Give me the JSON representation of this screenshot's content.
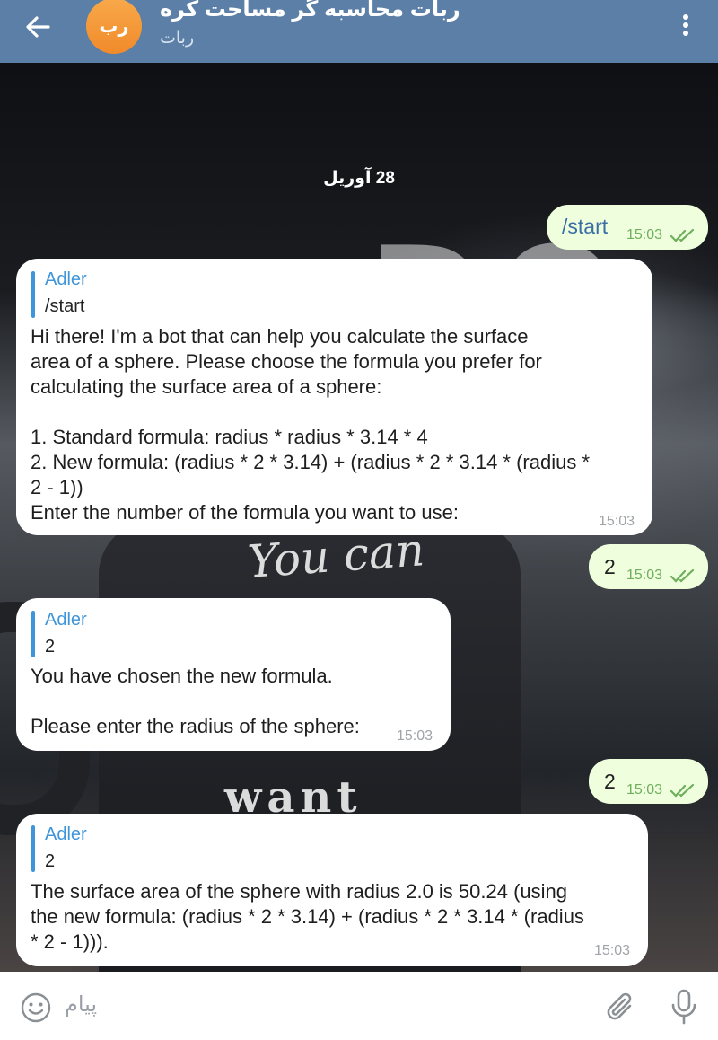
{
  "header": {
    "title": "ربات محاسبه گر مساحت کره",
    "subtitle": "ربات",
    "avatar_initials": "رب",
    "back_icon": "arrow-left-icon",
    "menu_icon": "more-vertical-icon"
  },
  "chat": {
    "date": "28 آوریل",
    "background_words": [
      "You can",
      "want"
    ],
    "messages": [
      {
        "direction": "out",
        "text": "/start",
        "time": "15:03"
      },
      {
        "direction": "in",
        "reply_name": "Adler",
        "reply_text": "/start",
        "text": "Hi there! I'm a bot that can help you calculate the surface\narea of a sphere. Please choose the formula you prefer for\ncalculating the surface area of a sphere:\n\n1. Standard formula: radius * radius * 3.14 * 4\n2. New formula: (radius * 2 * 3.14) + (radius * 2 * 3.14 * (radius *\n2 - 1))\nEnter the number of the formula you want to use:",
        "time": "15:03"
      },
      {
        "direction": "out",
        "text": "2",
        "time": "15:03"
      },
      {
        "direction": "in",
        "reply_name": "Adler",
        "reply_text": "2",
        "text": "You have chosen the new formula.\n\nPlease enter the radius of the sphere:",
        "time": "15:03"
      },
      {
        "direction": "out",
        "text": "2",
        "time": "15:03"
      },
      {
        "direction": "in",
        "reply_name": "Adler",
        "reply_text": "2",
        "text": "The surface area of the sphere with radius 2.0 is 50.24 (using\nthe new formula: (radius * 2 * 3.14) + (radius * 2 * 3.14 * (radius\n* 2 - 1))).",
        "time": "15:03"
      }
    ]
  },
  "input": {
    "placeholder": "پیام",
    "emoji_icon": "smiley-icon",
    "attach_icon": "paperclip-icon",
    "mic_icon": "microphone-icon"
  },
  "colors": {
    "header": "#5b7fa6",
    "out_bubble": "#efffde",
    "in_bubble": "#ffffff",
    "reply_accent": "#3f95d9",
    "check": "#6fae5c"
  }
}
